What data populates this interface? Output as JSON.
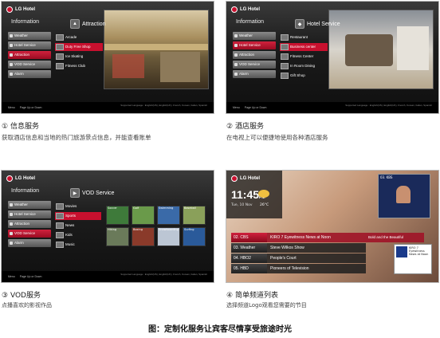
{
  "panels": [
    {
      "logo": "LG Hotel",
      "section": "Information",
      "service": "Attraction",
      "menu": [
        "Weather",
        "Hotel Service",
        "Attraction",
        "VOD Service",
        "Alarm"
      ],
      "menu_active": 2,
      "sub": [
        "Arcade",
        "Duty Free Shop",
        "Ice Skating",
        "Fitness Club"
      ],
      "sub_active": 1,
      "footer_num": "①",
      "footer_title": "信息服务",
      "footer_sub": "获取酒店信息和当地的热门旅游景点信息，并能查看账单",
      "bottom_left": [
        "Menu",
        "Page Up or Down"
      ],
      "supported": "Supported Language : English(US), English(UK), French, Korean, Italian, Spanish"
    },
    {
      "logo": "LG Hotel",
      "section": "Information",
      "service": "Hotel Service",
      "menu": [
        "Weather",
        "Hotel Service",
        "Attraction",
        "VOD Service",
        "Alarm"
      ],
      "menu_active": 1,
      "sub": [
        "Restaurant",
        "Business center",
        "Fitness Center",
        "In Room Dining",
        "Gift Shop"
      ],
      "sub_active": 1,
      "footer_num": "②",
      "footer_title": "酒店服务",
      "footer_sub": "在电视上可以便捷地使用各种酒店服务",
      "bottom_left": [
        "Menu",
        "Page Up or Down"
      ],
      "supported": "Supported Language : English(US), English(UK), French, Korean, Italian, Spanish"
    },
    {
      "logo": "LG Hotel",
      "section": "Information",
      "service": "VOD Service",
      "menu": [
        "Weather",
        "Hotel Service",
        "Attraction",
        "VOD Service",
        "Alarm"
      ],
      "menu_active": 3,
      "sub": [
        "Movies",
        "Sports",
        "News",
        "Kids",
        "Music"
      ],
      "sub_active": 1,
      "vod": [
        "Soccer",
        "Golf",
        "Swimming",
        "Baseball",
        "Hiking",
        "Boxing",
        "Snowboarding",
        "Surfing"
      ],
      "footer_num": "③",
      "footer_title": "VOD服务",
      "footer_sub": "点播喜欢的影视作品",
      "bottom_left": [
        "Menu",
        "Page Up or Down"
      ],
      "supported": "Supported Language : English(US), English(UK), French, Korean, Italian, Spanish"
    }
  ],
  "channel_panel": {
    "logo": "LG Hotel",
    "time": "11:45",
    "time_suffix": "PM",
    "date": "Tue, 10 Nov",
    "temp": "26°C",
    "preview_label": "03. KBS",
    "rows": [
      {
        "channel": "02. CBS",
        "program": "KIRO 7 Eyewitness News at Noon",
        "next": "Bold and the Beautiful"
      },
      {
        "channel": "03. Weather",
        "program": "Steve Wilkos Show",
        "next": ""
      },
      {
        "channel": "04. HBO2",
        "program": "People's Court",
        "next": ""
      },
      {
        "channel": "05. HBD",
        "program": "Pioneers of Television",
        "next": ""
      }
    ],
    "active_row": 0,
    "info_title": "KIRO 7 Eyewitness News at Noon",
    "footer_num": "④",
    "footer_title": "简单频道列表",
    "footer_sub": "选择频道Logo观看您需要的节目"
  },
  "figure_caption": "图：定制化服务让宾客尽情享受旅途时光",
  "colors": {
    "accent": "#c8102e",
    "dark": "#151515"
  }
}
